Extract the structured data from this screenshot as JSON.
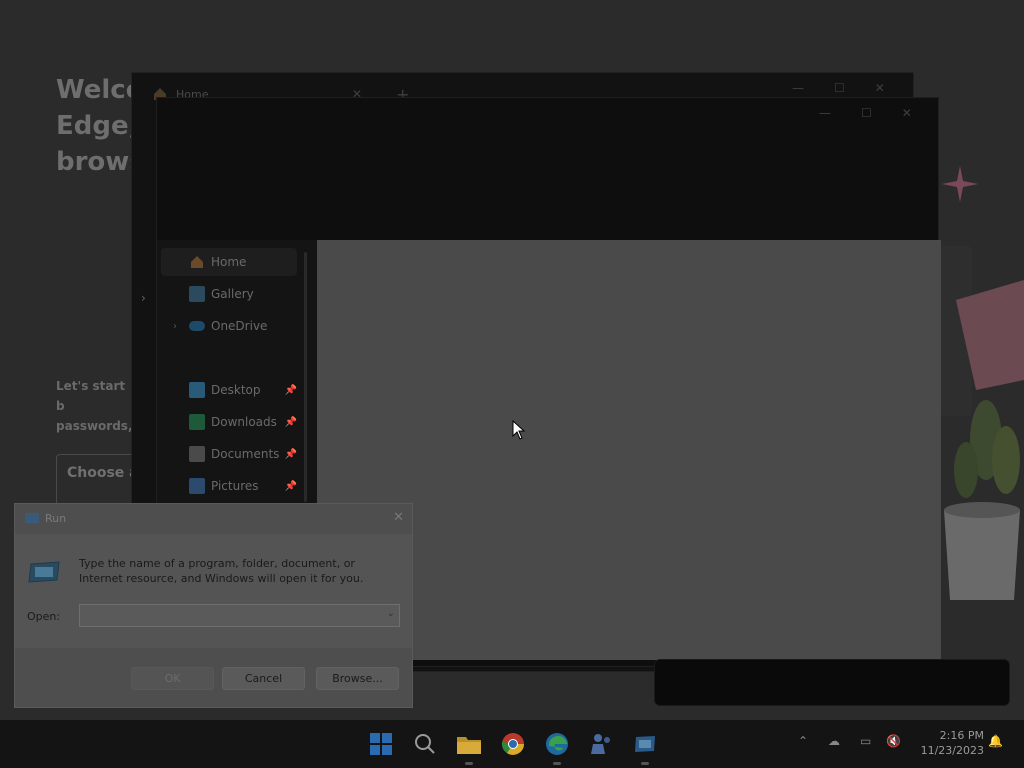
{
  "edge_page": {
    "title": "Welcome to Microsoft Edge, your AI-powered browser",
    "title_visible": "Welco\nEdge,\nbrows",
    "subtitle_visible": "Let's start b\npasswords,",
    "choose_visible": "Choose a"
  },
  "explorer_back": {
    "tab_label": "Home",
    "tab_close": "✕",
    "new_tab": "+",
    "minimize": "—",
    "maximize": "☐",
    "close": "✕"
  },
  "explorer_front": {
    "minimize": "—",
    "maximize": "☐",
    "close": "✕",
    "sidebar_items": [
      {
        "label": "Home",
        "icon": "home-icon",
        "pinned": false,
        "expandable": false
      },
      {
        "label": "Gallery",
        "icon": "gallery-icon",
        "pinned": false,
        "expandable": false
      },
      {
        "label": "OneDrive",
        "icon": "onedrive-icon",
        "pinned": false,
        "expandable": true
      },
      {
        "label": "Desktop",
        "icon": "desktop-icon",
        "pinned": true,
        "expandable": false
      },
      {
        "label": "Downloads",
        "icon": "downloads-icon",
        "pinned": true,
        "expandable": false
      },
      {
        "label": "Documents",
        "icon": "documents-icon",
        "pinned": true,
        "expandable": false
      },
      {
        "label": "Pictures",
        "icon": "pictures-icon",
        "pinned": true,
        "expandable": false
      }
    ]
  },
  "run_dialog": {
    "title": "Run",
    "close": "✕",
    "description": "Type the name of a program, folder, document, or Internet resource, and Windows will open it for you.",
    "open_label": "Open:",
    "open_value": "",
    "ok_label": "OK",
    "cancel_label": "Cancel",
    "browse_label": "Browse..."
  },
  "taskbar": {
    "apps": [
      "start-icon",
      "search-icon",
      "file-explorer-icon",
      "chrome-icon",
      "edge-icon",
      "teams-icon",
      "run-icon"
    ],
    "time": "2:16 PM",
    "date": "11/23/2023"
  },
  "colors": {
    "overlay_dim": "#262626",
    "content_area": "#4a4a4a",
    "run_dialog": "#4e4e4e"
  }
}
